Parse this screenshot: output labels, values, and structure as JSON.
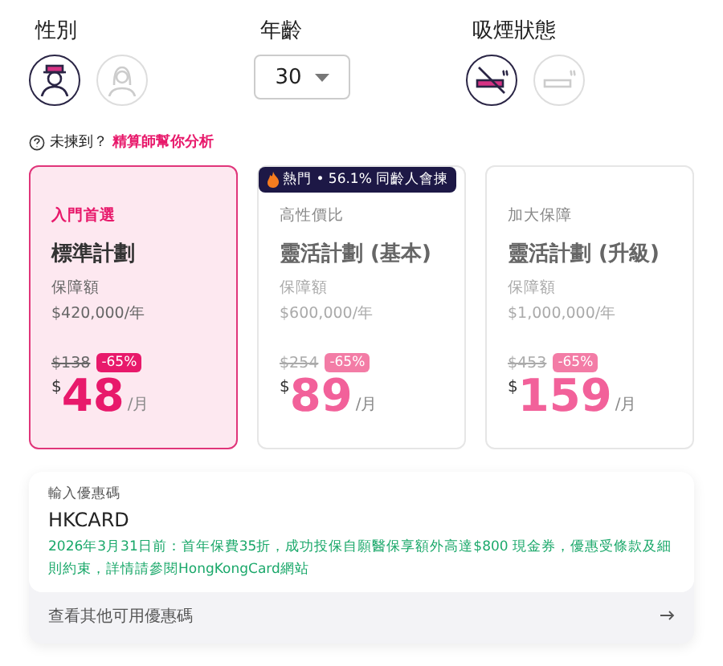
{
  "gender": {
    "label": "性別",
    "options": [
      {
        "kind": "male",
        "selected": true
      },
      {
        "kind": "female",
        "selected": false
      }
    ]
  },
  "age": {
    "label": "年齡",
    "value": "30"
  },
  "smoking": {
    "label": "吸煙狀態",
    "options": [
      {
        "kind": "non-smoker",
        "selected": true
      },
      {
        "kind": "smoker",
        "selected": false
      }
    ]
  },
  "hint": {
    "text": "未揀到？",
    "link": "精算師幫你分析"
  },
  "plans": [
    {
      "tag": "入門首選",
      "name": "標準計劃",
      "coverage_label": "保障額",
      "coverage": "$420,000/年",
      "original_price": "$138",
      "discount": "-65%",
      "currency": "$",
      "price": "48",
      "unit": "/月",
      "selected": true
    },
    {
      "tag": "高性價比",
      "name": "靈活計劃 (基本)",
      "coverage_label": "保障額",
      "coverage": "$600,000/年",
      "original_price": "$254",
      "discount": "-65%",
      "currency": "$",
      "price": "89",
      "unit": "/月",
      "selected": false,
      "badge": "熱門 • 56.1% 同齡人會揀"
    },
    {
      "tag": "加大保障",
      "name": "靈活計劃 (升級)",
      "coverage_label": "保障額",
      "coverage": "$1,000,000/年",
      "original_price": "$453",
      "discount": "-65%",
      "currency": "$",
      "price": "159",
      "unit": "/月",
      "selected": false
    }
  ],
  "promo": {
    "label": "輸入優惠碼",
    "value": "HKCARD",
    "note": "2026年3月31日前：首年保費35折，成功投保自願醫保享額外高達$800 現金券，優惠受條款及細則約束，詳情請參閱HongKongCard網站",
    "more": "查看其他可用優惠碼"
  }
}
